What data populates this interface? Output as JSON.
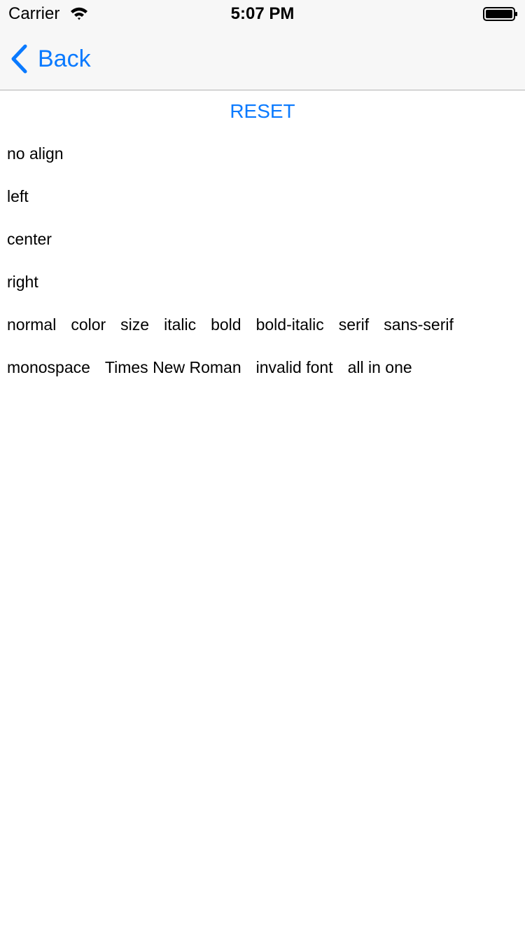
{
  "status_bar": {
    "carrier": "Carrier",
    "time": "5:07 PM"
  },
  "nav": {
    "back_label": "Back"
  },
  "reset_label": "RESET",
  "align_items": [
    "no align",
    "left",
    "center",
    "right"
  ],
  "style_items": [
    "normal",
    "color",
    "size",
    "italic",
    "bold",
    "bold-italic",
    "serif",
    "sans-serif"
  ],
  "font_items": [
    "monospace",
    "Times New Roman",
    "invalid font",
    "all in one"
  ],
  "colors": {
    "accent": "#0a7aff",
    "nav_background": "#f7f7f7",
    "separator": "#b2b2b2"
  }
}
